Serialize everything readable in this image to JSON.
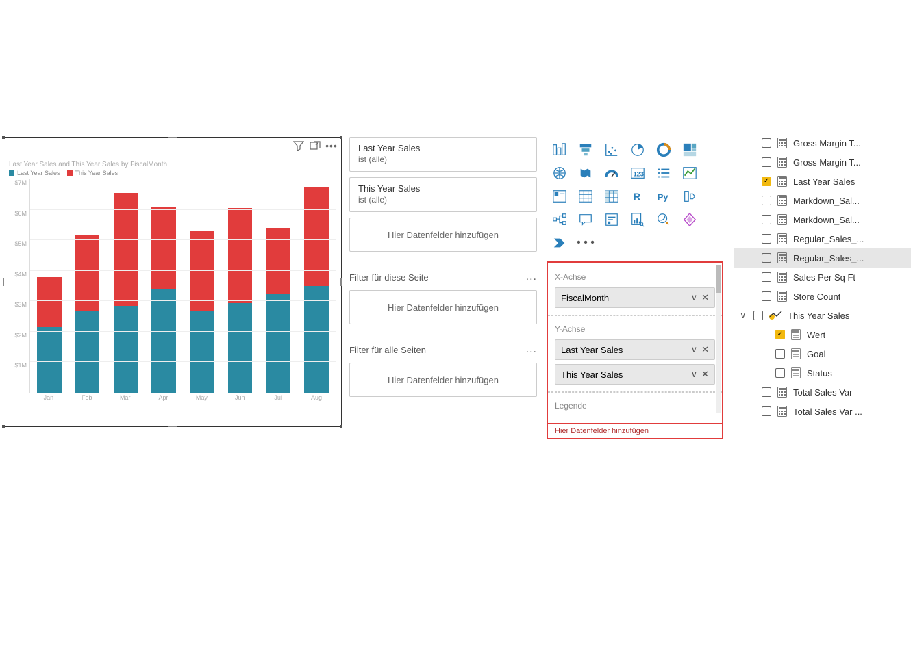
{
  "chart": {
    "title": "Last Year Sales and This Year Sales by FiscalMonth",
    "legend": {
      "s1": "Last Year Sales",
      "s2": "This Year Sales"
    }
  },
  "chart_data": {
    "type": "bar",
    "title": "Last Year Sales and This Year Sales by FiscalMonth",
    "xlabel": "",
    "ylabel": "",
    "ylim": [
      0,
      7000000
    ],
    "yticks": [
      "$7M",
      "$6M",
      "$5M",
      "$4M",
      "$3M",
      "$2M",
      "$1M"
    ],
    "categories": [
      "Jan",
      "Feb",
      "Mar",
      "Apr",
      "May",
      "Jun",
      "Jul",
      "Aug"
    ],
    "series": [
      {
        "name": "Last Year Sales",
        "color": "#2a8aa2",
        "values": [
          2150000,
          2700000,
          2850000,
          3400000,
          2700000,
          2950000,
          3250000,
          3500000
        ]
      },
      {
        "name": "This Year Sales",
        "color": "#e13c3c",
        "values": [
          1650000,
          2450000,
          3700000,
          2700000,
          2600000,
          3100000,
          2150000,
          3250000
        ]
      }
    ]
  },
  "filters": {
    "card1": {
      "title": "Last Year Sales",
      "sub": "ist (alle)"
    },
    "card2": {
      "title": "This Year Sales",
      "sub": "ist (alle)"
    },
    "drop_visual": "Hier Datenfelder hinzufügen",
    "section_page": "Filter für diese Seite",
    "drop_page": "Hier Datenfelder hinzufügen",
    "section_all": "Filter für alle Seiten",
    "drop_all": "Hier Datenfelder hinzufügen"
  },
  "gallery_ellipsis": "• • •",
  "wells": {
    "xaxis_label": "X-Achse",
    "xaxis_pill": "FiscalMonth",
    "yaxis_label": "Y-Achse",
    "yaxis_pill1": "Last Year Sales",
    "yaxis_pill2": "This Year Sales",
    "legend_label": "Legende",
    "hint": "Hier Datenfelder hinzufügen"
  },
  "fields": {
    "f0": "Gross Margin T...",
    "f1": "Gross Margin T...",
    "f2": "Last Year Sales",
    "f3": "Markdown_Sal...",
    "f4": "Markdown_Sal...",
    "f5": "Regular_Sales_...",
    "f6": "Regular_Sales_...",
    "f7": "Sales Per Sq Ft",
    "f8": "Store Count",
    "f9": "This Year Sales",
    "f9a": "Wert",
    "f9b": "Goal",
    "f9c": "Status",
    "f10": "Total Sales Var",
    "f11": "Total Sales Var ..."
  }
}
